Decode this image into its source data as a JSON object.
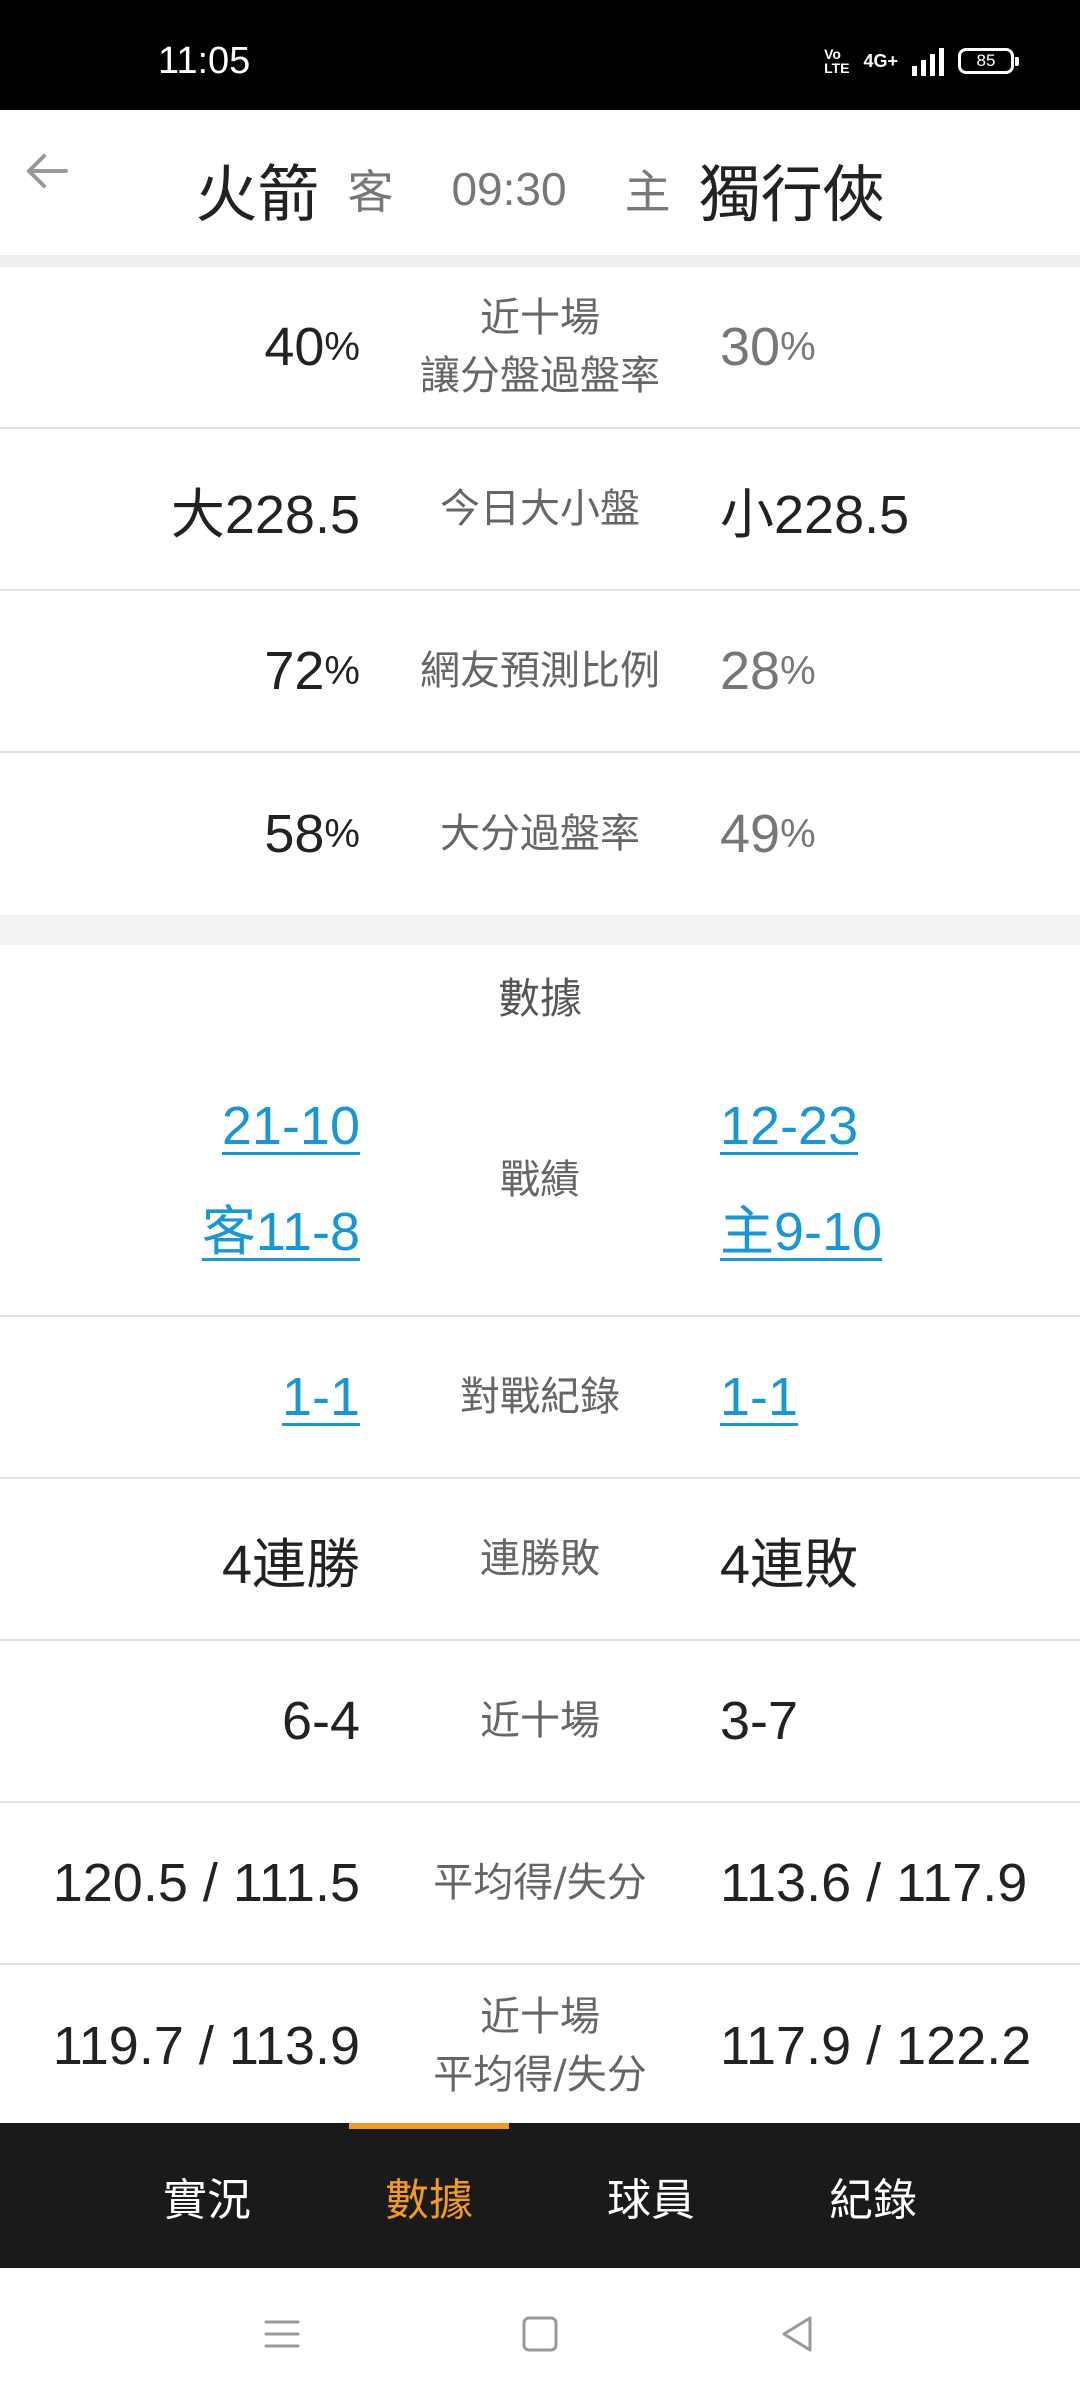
{
  "status_bar": {
    "time": "11:05",
    "volte": "Vo LTE",
    "network": "4G+",
    "battery": "85"
  },
  "header": {
    "away_team": "火箭",
    "away_label": "客",
    "game_time": "09:30",
    "home_label": "主",
    "home_team": "獨行俠"
  },
  "betting_rows": [
    {
      "label_line1": "近十場",
      "label_line2": "讓分盤過盤率",
      "away": "40",
      "home": "30",
      "unit": "%"
    },
    {
      "label": "今日大小盤",
      "away": "大228.5",
      "home": "小228.5"
    },
    {
      "label": "網友預測比例",
      "away": "72",
      "home": "28",
      "unit": "%"
    },
    {
      "label": "大分過盤率",
      "away": "58",
      "home": "49",
      "unit": "%"
    }
  ],
  "stats_section": {
    "title": "數據",
    "record": {
      "label": "戰績",
      "away_overall": "21-10",
      "away_split": "客11-8",
      "home_overall": "12-23",
      "home_split": "主9-10"
    },
    "head_to_head": {
      "label": "對戰紀錄",
      "away": "1-1",
      "home": "1-1"
    },
    "streak": {
      "label": "連勝敗",
      "away": "4連勝",
      "home": "4連敗"
    },
    "last_ten": {
      "label": "近十場",
      "away": "6-4",
      "home": "3-7"
    },
    "avg_points": {
      "label": "平均得/失分",
      "away": "120.5 / 111.5",
      "home": "113.6 / 117.9"
    },
    "last_ten_avg": {
      "label_line1": "近十場",
      "label_line2": "平均得/失分",
      "away": "119.7 / 113.9",
      "home": "117.9 / 122.2"
    }
  },
  "tabs": [
    {
      "label": "實況",
      "active": false
    },
    {
      "label": "數據",
      "active": true
    },
    {
      "label": "球員",
      "active": false
    },
    {
      "label": "紀錄",
      "active": false
    }
  ],
  "colors": {
    "accent": "#f39a23",
    "link": "#1a96d4",
    "tabbar": "#1a1a1a"
  },
  "icons": {
    "back": "arrow-left-icon",
    "menu": "menu-icon",
    "home": "home-square-icon",
    "back_nav": "triangle-back-icon"
  }
}
